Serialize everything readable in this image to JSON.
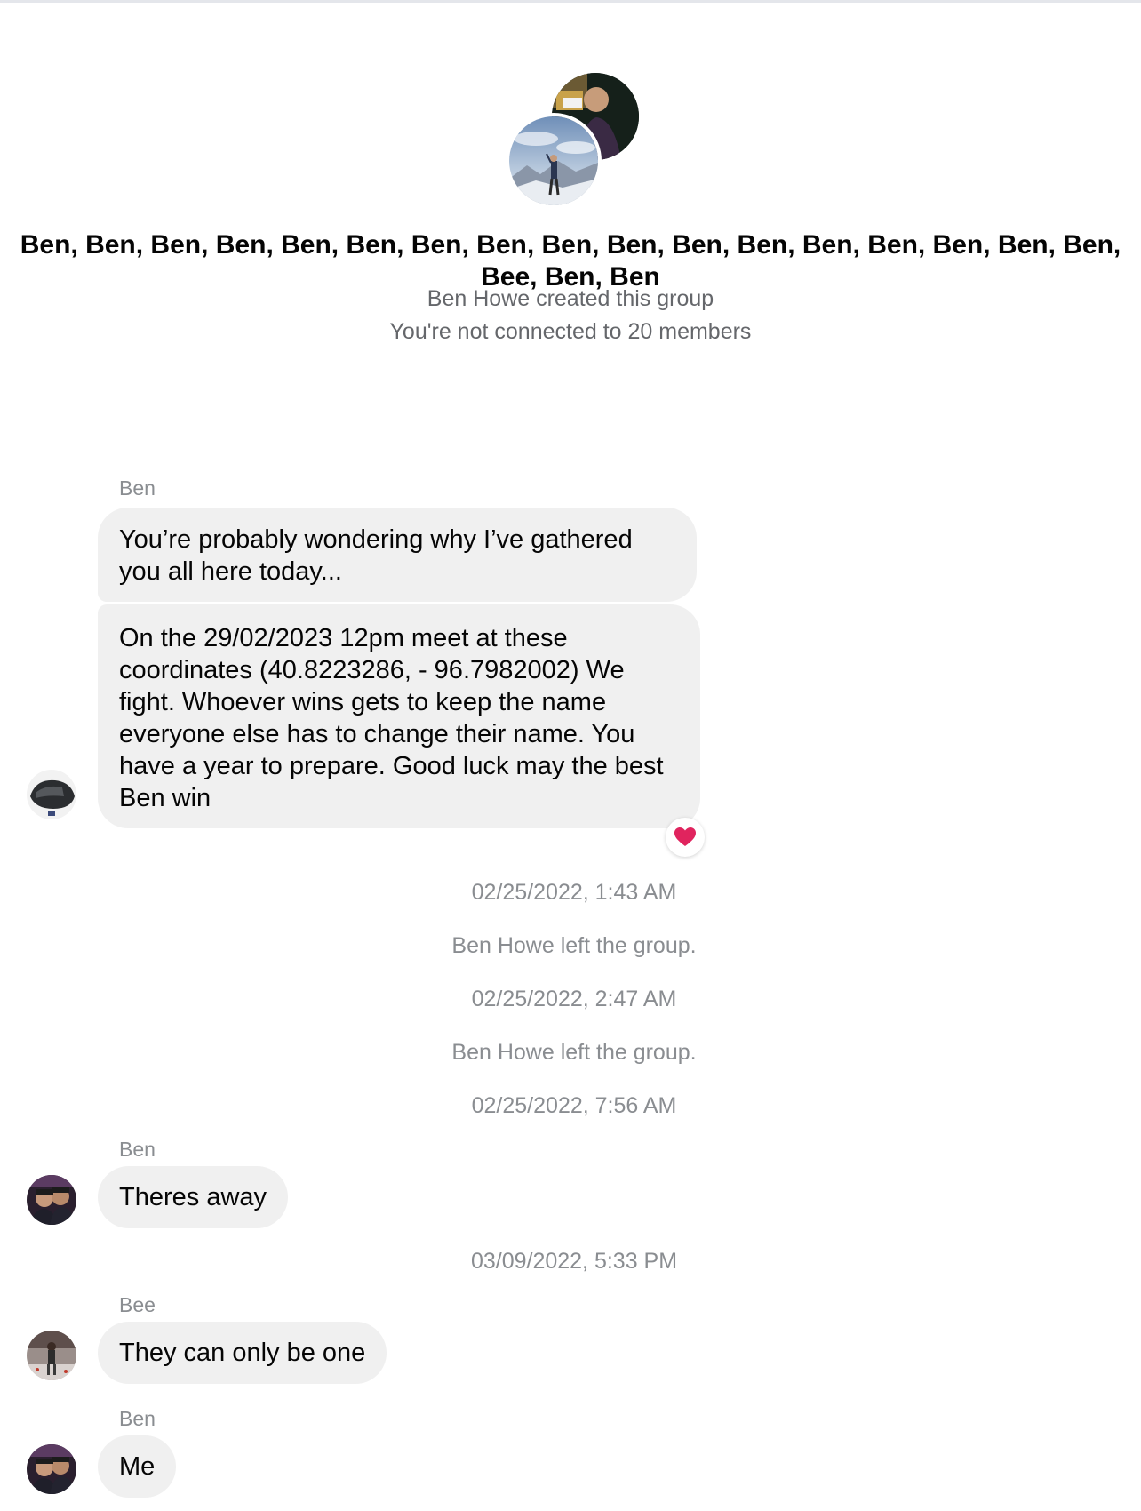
{
  "group": {
    "name": "Ben, Ben, Ben, Ben, Ben, Ben, Ben, Ben, Ben, Ben, Ben, Ben, Ben, Ben, Ben, Ben, Ben, Bee, Ben, Ben",
    "created_text": "Ben Howe created this group",
    "connection_text": "You're not connected to 20 members",
    "avatar_icons": [
      "person-selfie-photo",
      "mountain-hiker-photo"
    ]
  },
  "messages": [
    {
      "sender": "Ben",
      "text": "You’re probably wondering why I’ve gathered you all here today..."
    },
    {
      "text": "On the 29/02/2023 12pm meet at these coordinates (40.8223286, - 96.7982002) We fight. Whoever wins gets to keep the name everyone else has to change their name. You have a year to prepare. Good luck may the best Ben win",
      "reaction": "heart",
      "reaction_glyph": "❤️"
    }
  ],
  "events": [
    {
      "timestamp": "02/25/2022, 1:43 AM"
    },
    {
      "text": "Ben Howe left the group."
    },
    {
      "timestamp": "02/25/2022, 2:47 AM"
    },
    {
      "text": "Ben Howe left the group."
    },
    {
      "timestamp": "02/25/2022, 7:56 AM"
    }
  ],
  "later": [
    {
      "sender": "Ben",
      "text": "Theres away"
    },
    {
      "timestamp": "03/09/2022, 5:33 PM"
    },
    {
      "sender": "Bee",
      "text": "They can only be one"
    },
    {
      "sender": "Ben",
      "text": "Me"
    }
  ],
  "colors": {
    "bubble": "#f0f0f0",
    "muted": "#8a8d91",
    "reaction": "#e0245e"
  }
}
